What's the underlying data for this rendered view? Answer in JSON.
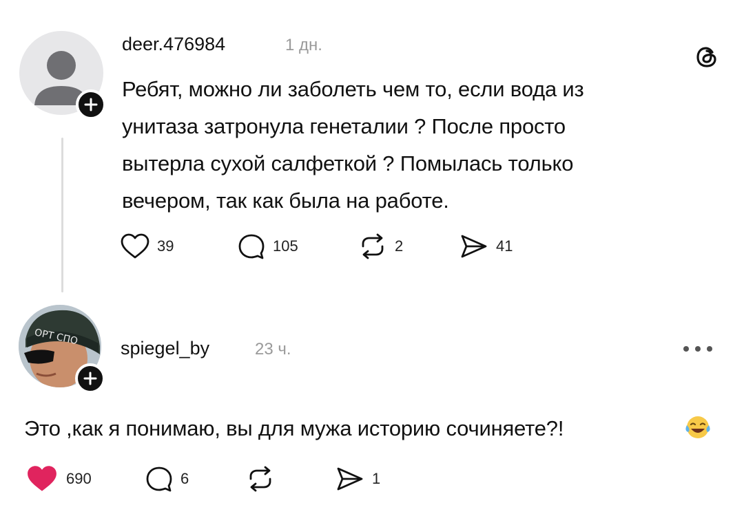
{
  "post": {
    "username": "deer.476984",
    "time": "1 дн.",
    "text_lines": [
      "Ребят, можно ли заболеть чем то, если вода из",
      "унитаза затронула генеталии ? После просто",
      "вытерла сухой салфеткой ? Помылась только",
      "вечером, так как была на работе."
    ],
    "likes": "39",
    "comments": "105",
    "reposts": "2",
    "shares": "41"
  },
  "reply": {
    "username": "spiegel_by",
    "time": "23 ч.",
    "text": "Это ,как я понимаю, вы для мужа историю сочиняете?!",
    "likes": "690",
    "comments": "6",
    "shares": "1",
    "avatar_caps_text": "ОРТ СПО"
  },
  "icons": {
    "app_logo": "threads-logo-icon",
    "more": "more-dots-icon",
    "emoji": "laughing-tears-emoji-icon"
  },
  "colors": {
    "like_active": "#e0245e",
    "muted": "#9a9a9a"
  }
}
